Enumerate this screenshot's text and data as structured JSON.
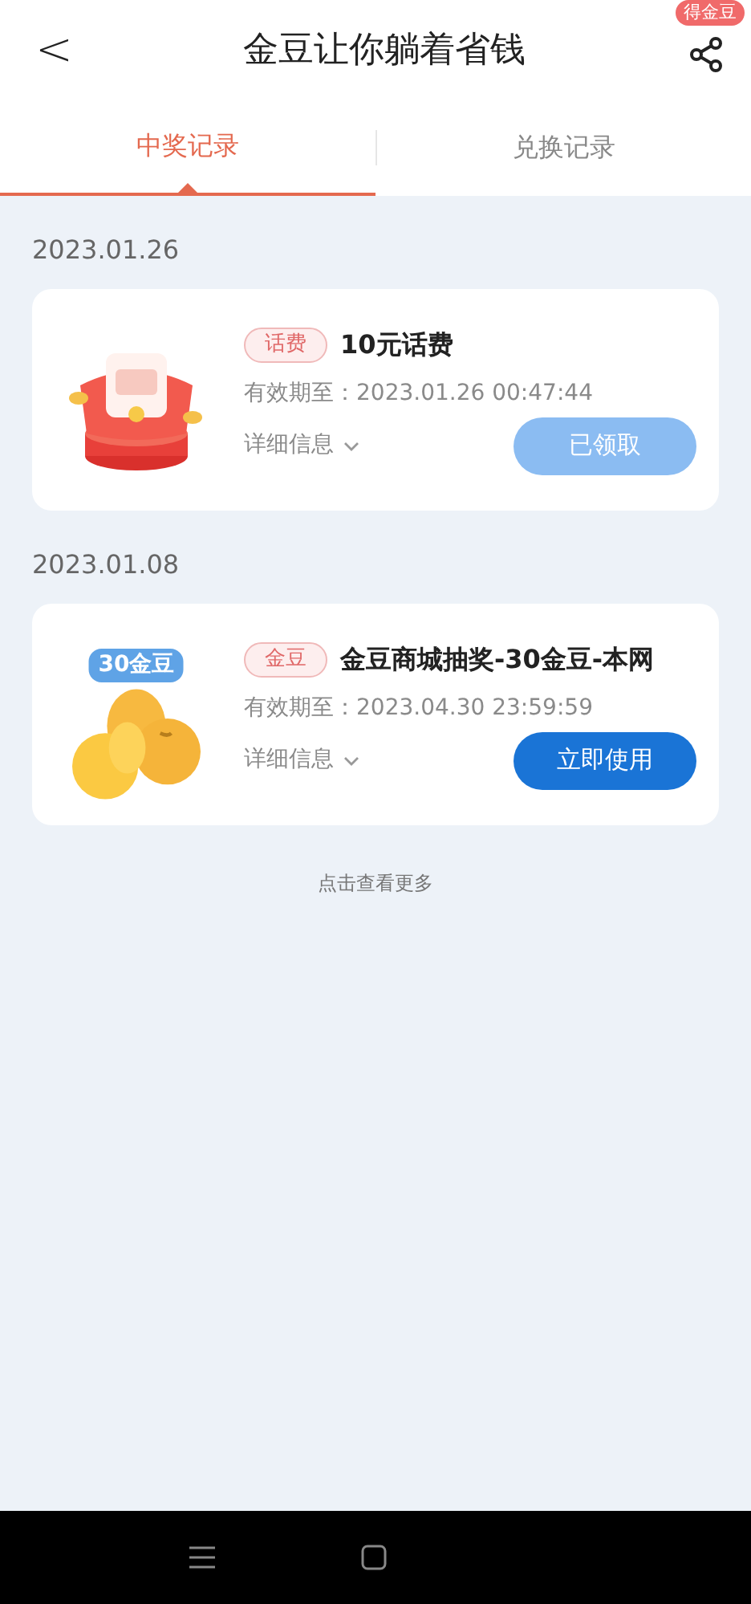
{
  "header": {
    "back": "<",
    "title": "金豆让你躺着省钱",
    "badge": "得金豆"
  },
  "tabs": [
    {
      "label": "中奖记录",
      "selected": true
    },
    {
      "label": "兑换记录",
      "selected": false
    }
  ],
  "groups": [
    {
      "date": "2023.01.26",
      "records": [
        {
          "kind": "phone-credit",
          "tag": "话费",
          "title": "10元话费",
          "expiry": "有效期至：2023.01.26 00:47:44",
          "details": "详细信息",
          "button": "已领取",
          "disabled": true
        }
      ]
    },
    {
      "date": "2023.01.08",
      "records": [
        {
          "kind": "beans",
          "image_label": "30金豆",
          "tag": "金豆",
          "title": "金豆商城抽奖-30金豆-本网",
          "expiry": "有效期至：2023.04.30 23:59:59",
          "details": "详细信息",
          "button": "立即使用",
          "disabled": false
        }
      ]
    }
  ],
  "more": "点击查看更多"
}
